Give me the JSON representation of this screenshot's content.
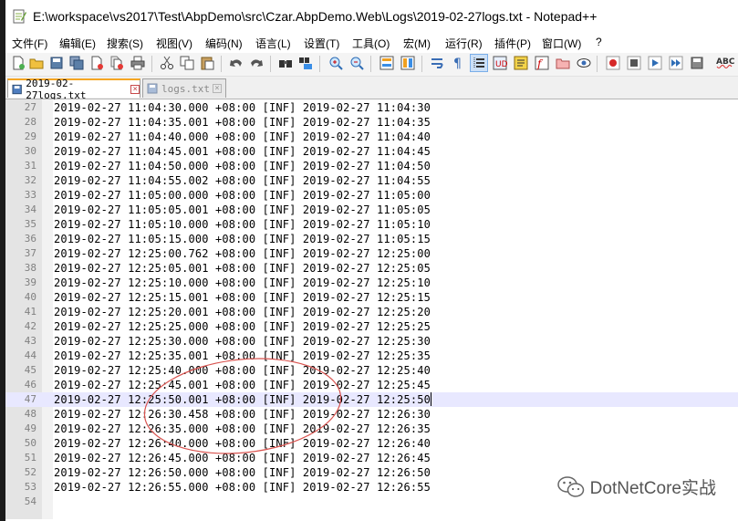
{
  "window": {
    "title": "E:\\workspace\\vs2017\\Test\\AbpDemo\\src\\Czar.AbpDemo.Web\\Logs\\2019-02-27logs.txt - Notepad++"
  },
  "menu": [
    {
      "label": "文件(F)",
      "id": "file"
    },
    {
      "label": "编辑(E)",
      "id": "edit"
    },
    {
      "label": "搜索(S)",
      "id": "search"
    },
    {
      "label": "视图(V)",
      "id": "view"
    },
    {
      "label": "编码(N)",
      "id": "encoding"
    },
    {
      "label": "语言(L)",
      "id": "language"
    },
    {
      "label": "设置(T)",
      "id": "settings"
    },
    {
      "label": "工具(O)",
      "id": "tools"
    },
    {
      "label": "宏(M)",
      "id": "macro"
    },
    {
      "label": "运行(R)",
      "id": "run"
    },
    {
      "label": "插件(P)",
      "id": "plugins"
    },
    {
      "label": "窗口(W)",
      "id": "window"
    },
    {
      "label": "?",
      "id": "help"
    }
  ],
  "toolbar": {
    "buttons": [
      "new-file",
      "open-file",
      "save",
      "save-all",
      "close",
      "close-all",
      "print",
      "cut",
      "copy",
      "paste",
      "undo",
      "redo",
      "find",
      "replace",
      "zoom-in",
      "zoom-out",
      "sync-vertical",
      "sync-horizontal",
      "word-wrap",
      "show-all-chars",
      "indent-guide",
      "language-ud",
      "doc-map",
      "function-list",
      "folder-workspace",
      "monitor",
      "record-macro",
      "stop-record",
      "play-macro",
      "run-macro-multiple",
      "save-macro",
      "spell-check"
    ],
    "active": "indent-guide",
    "spell_label": "ABC"
  },
  "tabs": [
    {
      "label": "2019-02-27logs.txt",
      "active": true
    },
    {
      "label": "logs.txt",
      "active": false
    }
  ],
  "editor": {
    "current_line": 47,
    "lines": [
      {
        "n": "27",
        "text": "2019-02-27 11:04:30.000 +08:00 [INF] 2019-02-27 11:04:30"
      },
      {
        "n": "28",
        "text": "2019-02-27 11:04:35.001 +08:00 [INF] 2019-02-27 11:04:35"
      },
      {
        "n": "29",
        "text": "2019-02-27 11:04:40.000 +08:00 [INF] 2019-02-27 11:04:40"
      },
      {
        "n": "30",
        "text": "2019-02-27 11:04:45.001 +08:00 [INF] 2019-02-27 11:04:45"
      },
      {
        "n": "31",
        "text": "2019-02-27 11:04:50.000 +08:00 [INF] 2019-02-27 11:04:50"
      },
      {
        "n": "32",
        "text": "2019-02-27 11:04:55.002 +08:00 [INF] 2019-02-27 11:04:55"
      },
      {
        "n": "33",
        "text": "2019-02-27 11:05:00.000 +08:00 [INF] 2019-02-27 11:05:00"
      },
      {
        "n": "34",
        "text": "2019-02-27 11:05:05.001 +08:00 [INF] 2019-02-27 11:05:05"
      },
      {
        "n": "35",
        "text": "2019-02-27 11:05:10.000 +08:00 [INF] 2019-02-27 11:05:10"
      },
      {
        "n": "36",
        "text": "2019-02-27 11:05:15.000 +08:00 [INF] 2019-02-27 11:05:15"
      },
      {
        "n": "37",
        "text": "2019-02-27 12:25:00.762 +08:00 [INF] 2019-02-27 12:25:00"
      },
      {
        "n": "38",
        "text": "2019-02-27 12:25:05.001 +08:00 [INF] 2019-02-27 12:25:05"
      },
      {
        "n": "39",
        "text": "2019-02-27 12:25:10.000 +08:00 [INF] 2019-02-27 12:25:10"
      },
      {
        "n": "40",
        "text": "2019-02-27 12:25:15.001 +08:00 [INF] 2019-02-27 12:25:15"
      },
      {
        "n": "41",
        "text": "2019-02-27 12:25:20.001 +08:00 [INF] 2019-02-27 12:25:20"
      },
      {
        "n": "42",
        "text": "2019-02-27 12:25:25.000 +08:00 [INF] 2019-02-27 12:25:25"
      },
      {
        "n": "43",
        "text": "2019-02-27 12:25:30.000 +08:00 [INF] 2019-02-27 12:25:30"
      },
      {
        "n": "44",
        "text": "2019-02-27 12:25:35.001 +08:00 [INF] 2019-02-27 12:25:35"
      },
      {
        "n": "45",
        "text": "2019-02-27 12:25:40.000 +08:00 [INF] 2019-02-27 12:25:40"
      },
      {
        "n": "46",
        "text": "2019-02-27 12:25:45.001 +08:00 [INF] 2019-02-27 12:25:45"
      },
      {
        "n": "47",
        "text": "2019-02-27 12:25:50.001 +08:00 [INF] 2019-02-27 12:25:50"
      },
      {
        "n": "48",
        "text": "2019-02-27 12:26:30.458 +08:00 [INF] 2019-02-27 12:26:30"
      },
      {
        "n": "49",
        "text": "2019-02-27 12:26:35.000 +08:00 [INF] 2019-02-27 12:26:35"
      },
      {
        "n": "50",
        "text": "2019-02-27 12:26:40.000 +08:00 [INF] 2019-02-27 12:26:40"
      },
      {
        "n": "51",
        "text": "2019-02-27 12:26:45.000 +08:00 [INF] 2019-02-27 12:26:45"
      },
      {
        "n": "52",
        "text": "2019-02-27 12:26:50.000 +08:00 [INF] 2019-02-27 12:26:50"
      },
      {
        "n": "53",
        "text": "2019-02-27 12:26:55.000 +08:00 [INF] 2019-02-27 12:26:55"
      },
      {
        "n": "54",
        "text": ""
      }
    ]
  },
  "watermark": {
    "text": "DotNetCore实战"
  },
  "colors": {
    "annotation": "#d9534f",
    "current_line": "#e8e8ff",
    "tab_accent": "#f5a623"
  }
}
